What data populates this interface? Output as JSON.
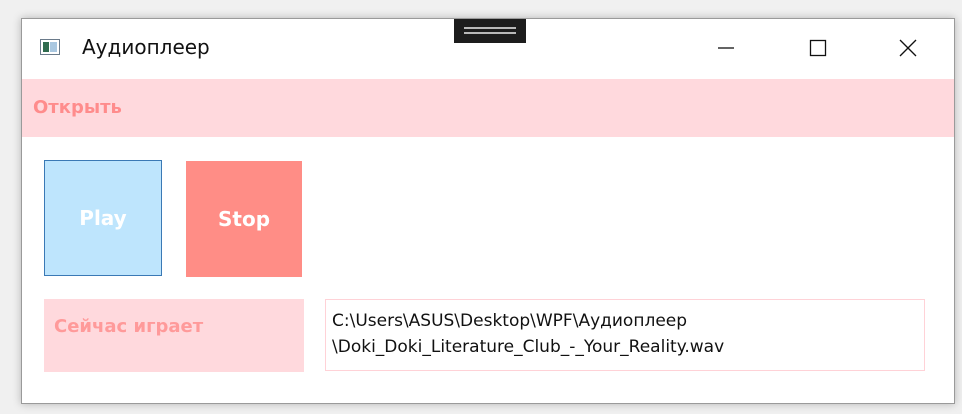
{
  "window": {
    "title": "Аудиоплеер",
    "icon": "app-window-icon"
  },
  "caption_buttons": {
    "minimize_icon": "minimize-icon",
    "maximize_icon": "maximize-icon",
    "close_icon": "close-icon"
  },
  "menu": {
    "open_label": "Открыть"
  },
  "controls": {
    "play_label": "Play",
    "stop_label": "Stop"
  },
  "status": {
    "now_playing_label": "Сейчас играет",
    "current_file": "C:\\Users\\ASUS\\Desktop\\WPF\\Аудиоплеер\n\\Doki_Doki_Literature_Club_-_Your_Reality.wav"
  },
  "colors": {
    "menu_background": "#ffd9dd",
    "menu_text": "#ff8c8c",
    "play_background": "#bee5fd",
    "play_border": "#3a79b5",
    "stop_background": "#ff8d86",
    "label_background": "#ffd9dd",
    "label_text": "#ff9a9a"
  }
}
